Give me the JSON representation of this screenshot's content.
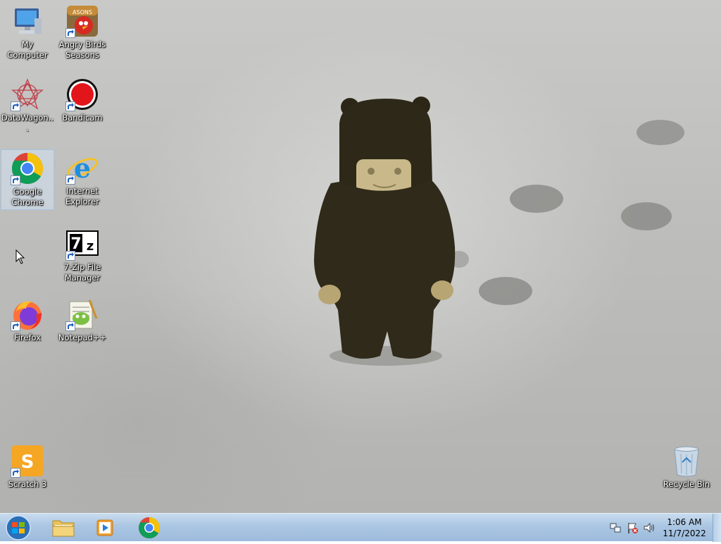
{
  "desktop": {
    "icons": [
      {
        "label": "My Computer",
        "icon": "computer-icon",
        "shortcut": false
      },
      {
        "label": "Angry Birds\nSeasons",
        "icon": "angry-birds-icon",
        "shortcut": true
      },
      {
        "label": "DataWagon...",
        "icon": "datawagon-icon",
        "shortcut": true
      },
      {
        "label": "Bandicam",
        "icon": "bandicam-icon",
        "shortcut": true
      },
      {
        "label": "Google\nChrome",
        "icon": "chrome-icon",
        "shortcut": true,
        "selected": true
      },
      {
        "label": "Internet\nExplorer",
        "icon": "ie-icon",
        "shortcut": true
      },
      {
        "label": "7-Zip File\nManager",
        "icon": "7zip-icon",
        "shortcut": true
      },
      {
        "label": "Firefox",
        "icon": "firefox-icon",
        "shortcut": true
      },
      {
        "label": "Notepad++",
        "icon": "notepadpp-icon",
        "shortcut": true
      },
      {
        "label": "Scratch 3",
        "icon": "scratch-icon",
        "shortcut": true
      },
      {
        "label": "Recycle Bin",
        "icon": "recycle-bin-icon",
        "shortcut": false
      }
    ]
  },
  "taskbar": {
    "start_icon": "windows-start-icon",
    "pinned": [
      {
        "name": "file-explorer",
        "icon": "folder-icon"
      },
      {
        "name": "media-player",
        "icon": "media-player-icon"
      },
      {
        "name": "chrome",
        "icon": "chrome-icon"
      }
    ],
    "tray_icons": [
      "network-icon",
      "action-center-flag-icon",
      "volume-icon"
    ],
    "clock": {
      "time": "1:06 AM",
      "date": "11/7/2022"
    }
  },
  "colors": {
    "taskbar": "#a9c5e2",
    "selection": "#d7ebff",
    "chrome_red": "#db4437",
    "chrome_yellow": "#f4c20d",
    "chrome_green": "#0f9d58",
    "chrome_blue": "#4285f4"
  }
}
